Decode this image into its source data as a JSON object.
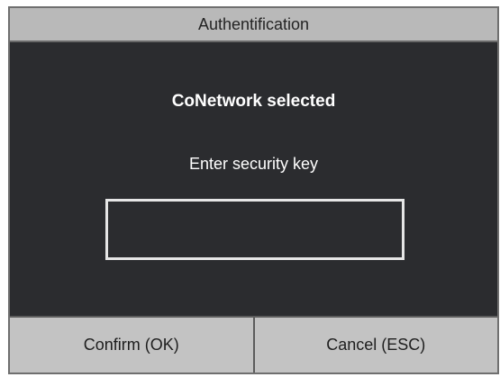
{
  "dialog": {
    "title": "Authentification",
    "network_text": "CoNetwork selected",
    "prompt_text": "Enter security key",
    "key_input": {
      "value": "",
      "placeholder": ""
    },
    "buttons": {
      "confirm_label": "Confirm (OK)",
      "cancel_label": "Cancel (ESC)"
    }
  },
  "colors": {
    "dialog_background": "#2b2c2f",
    "title_bar": "#b9b9b9",
    "buttons": "#c3c3c3",
    "input_border": "#e6e6e6"
  }
}
